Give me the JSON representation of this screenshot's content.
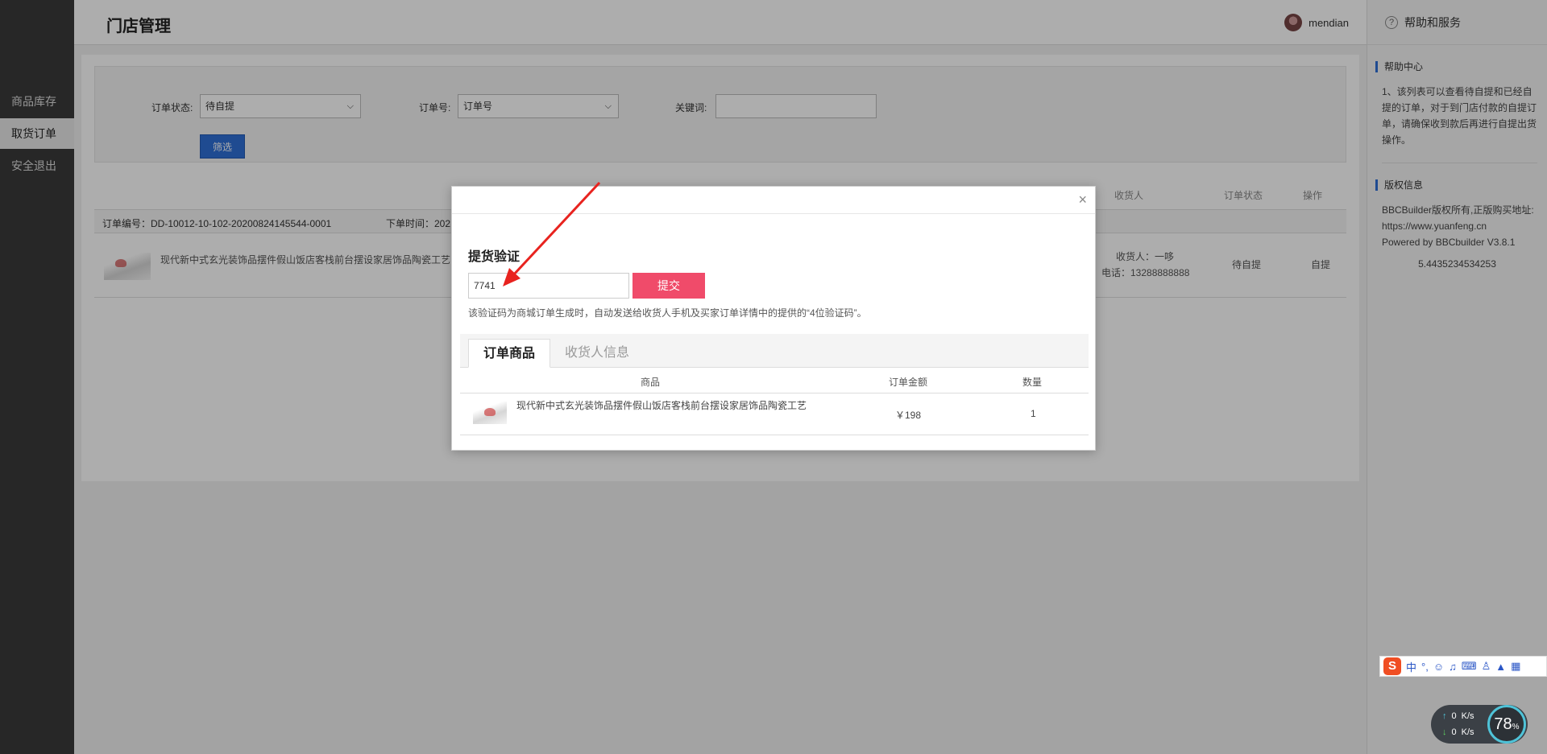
{
  "sidebar": {
    "items": [
      {
        "label": "商品库存"
      },
      {
        "label": "取货订单"
      },
      {
        "label": "安全退出"
      }
    ]
  },
  "header": {
    "title": "门店管理",
    "username": "mendian"
  },
  "help": {
    "title": "帮助和服务",
    "help_center_title": "帮助中心",
    "help_center_text": "1、该列表可以查看待自提和已经自提的订单，对于到门店付款的自提订单，请确保收到款后再进行自提出货操作。",
    "copyright_title": "版权信息",
    "copyright_text": "BBCBuilder版权所有,正版购买地址: https://www.yuanfeng.cn",
    "powered_by": "Powered by BBCbuilder V3.8.1",
    "version_number": "5.4435234534253"
  },
  "filters": {
    "status_label": "订单状态:",
    "status_value": "待自提",
    "order_no_label": "订单号:",
    "order_no_value": "订单号",
    "keyword_label": "关键词:",
    "filter_button": "筛选"
  },
  "table": {
    "headers": {
      "receiver": "收货人",
      "status": "订单状态",
      "action": "操作"
    },
    "order": {
      "number": "订单编号：DD-10012-10-102-20200824145544-0001",
      "time": "下单时间：202",
      "product": "现代新中式玄光装饰品摆件假山饭店客栈前台摆设家居饰品陶瓷工艺",
      "receiver_name": "收货人：一哆",
      "receiver_phone": "电话：13288888888",
      "status": "待自提",
      "action": "自提"
    }
  },
  "modal": {
    "close_symbol": "×",
    "title": "提货验证",
    "code_value": "7741",
    "submit_label": "提交",
    "hint": "该验证码为商城订单生成时，自动发送给收货人手机及买家订单详情中的提供的“4位验证码”。",
    "tabs": [
      {
        "label": "订单商品"
      },
      {
        "label": "收货人信息"
      }
    ],
    "columns": {
      "product": "商品",
      "amount": "订单金额",
      "quantity": "数量"
    },
    "rows": [
      {
        "product": "现代新中式玄光装饰品摆件假山饭店客栈前台摆设家居饰品陶瓷工艺",
        "amount": "￥198",
        "quantity": "1"
      }
    ]
  },
  "system": {
    "ime": {
      "logo": "S",
      "mode": "中",
      "punct": "°,"
    },
    "speed": {
      "up": "0",
      "down": "0",
      "unit": "K/s",
      "percent": "78",
      "percent_unit": "%"
    }
  }
}
